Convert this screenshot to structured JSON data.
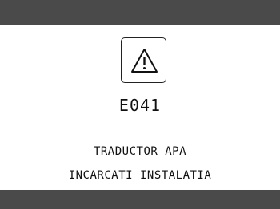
{
  "header": {
    "color": "#4a4a4a"
  },
  "alert": {
    "icon": "warning-icon",
    "code": "E041",
    "message_line_1": "TRADUCTOR APA",
    "message_line_2": "INCARCATI INSTALATIA"
  },
  "footer": {
    "color": "#4a4a4a"
  }
}
